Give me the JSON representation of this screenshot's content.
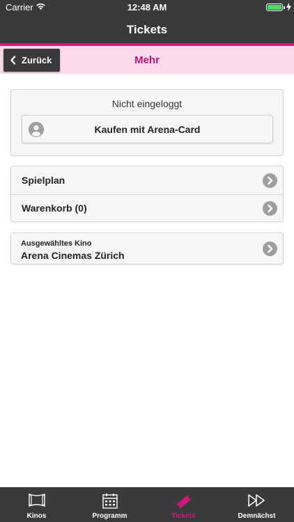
{
  "status_bar": {
    "carrier": "Carrier",
    "time": "12:48 AM"
  },
  "nav": {
    "title": "Tickets"
  },
  "subheader": {
    "back_label": "Zurück",
    "title": "Mehr"
  },
  "login": {
    "status": "Nicht eingeloggt",
    "arena_button": "Kaufen mit Arena-Card"
  },
  "menu": {
    "items": [
      {
        "label": "Spielplan"
      },
      {
        "label": "Warenkorb (0)"
      }
    ]
  },
  "cinema": {
    "caption": "Ausgewähltes Kino",
    "name": "Arena Cinemas Zürich"
  },
  "tabs": [
    {
      "label": "Kinos",
      "icon": "cinema-screen-icon"
    },
    {
      "label": "Programm",
      "icon": "calendar-icon"
    },
    {
      "label": "Tickets",
      "icon": "ticket-icon",
      "active": true
    },
    {
      "label": "Demnächst",
      "icon": "fast-forward-icon"
    }
  ],
  "colors": {
    "accent": "#d4167f",
    "dark": "#3a3a3a",
    "subheader_bg": "#fcd9ea",
    "battery": "#4cd964"
  }
}
